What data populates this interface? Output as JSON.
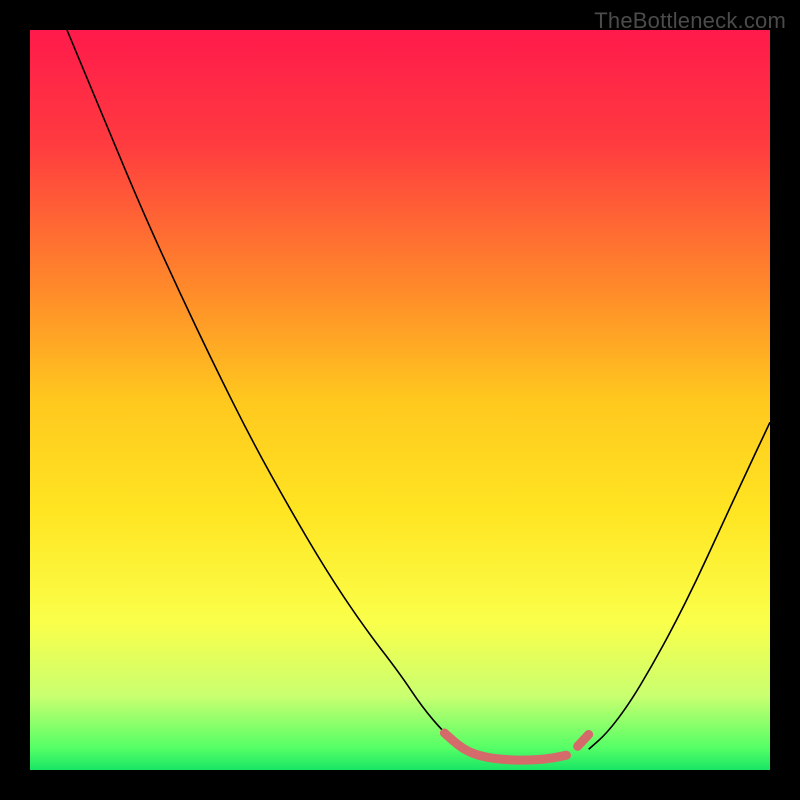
{
  "watermark": "TheBottleneck.com",
  "chart_data": {
    "type": "line",
    "title": "",
    "xlabel": "",
    "ylabel": "",
    "xlim": [
      0,
      100
    ],
    "ylim": [
      0,
      100
    ],
    "grid": false,
    "legend": "none",
    "background_gradient": {
      "stops": [
        {
          "pos": 0.0,
          "color": "#ff1a4b"
        },
        {
          "pos": 0.15,
          "color": "#ff3a40"
        },
        {
          "pos": 0.35,
          "color": "#ff8a2a"
        },
        {
          "pos": 0.5,
          "color": "#ffc81e"
        },
        {
          "pos": 0.65,
          "color": "#ffe522"
        },
        {
          "pos": 0.8,
          "color": "#faff4a"
        },
        {
          "pos": 0.9,
          "color": "#c9ff70"
        },
        {
          "pos": 0.97,
          "color": "#55ff66"
        },
        {
          "pos": 1.0,
          "color": "#19e565"
        }
      ]
    },
    "series": [
      {
        "name": "left-curve",
        "color": "#000000",
        "width": 1.6,
        "points": [
          {
            "x": 5.0,
            "y": 100.0
          },
          {
            "x": 10.0,
            "y": 88.0
          },
          {
            "x": 15.0,
            "y": 76.0
          },
          {
            "x": 20.0,
            "y": 65.0
          },
          {
            "x": 25.0,
            "y": 54.5
          },
          {
            "x": 30.0,
            "y": 44.5
          },
          {
            "x": 35.0,
            "y": 35.5
          },
          {
            "x": 40.0,
            "y": 27.0
          },
          {
            "x": 45.0,
            "y": 19.5
          },
          {
            "x": 50.0,
            "y": 13.0
          },
          {
            "x": 53.0,
            "y": 8.5
          },
          {
            "x": 56.0,
            "y": 5.0
          },
          {
            "x": 58.5,
            "y": 2.8
          }
        ]
      },
      {
        "name": "right-curve",
        "color": "#000000",
        "width": 1.6,
        "points": [
          {
            "x": 75.5,
            "y": 2.8
          },
          {
            "x": 78.0,
            "y": 5.0
          },
          {
            "x": 81.0,
            "y": 9.0
          },
          {
            "x": 84.0,
            "y": 14.0
          },
          {
            "x": 87.0,
            "y": 19.5
          },
          {
            "x": 90.0,
            "y": 25.5
          },
          {
            "x": 93.0,
            "y": 32.0
          },
          {
            "x": 96.0,
            "y": 38.5
          },
          {
            "x": 100.0,
            "y": 47.0
          }
        ]
      },
      {
        "name": "valley-segment",
        "color": "#d46a6a",
        "width": 9,
        "linecap": "round",
        "points": [
          {
            "x": 56.0,
            "y": 5.0
          },
          {
            "x": 58.5,
            "y": 2.8
          },
          {
            "x": 61.0,
            "y": 1.8
          },
          {
            "x": 64.0,
            "y": 1.4
          },
          {
            "x": 67.0,
            "y": 1.3
          },
          {
            "x": 70.0,
            "y": 1.5
          },
          {
            "x": 72.5,
            "y": 2.0
          }
        ]
      },
      {
        "name": "valley-dot-right",
        "color": "#d46a6a",
        "width": 9,
        "linecap": "round",
        "points": [
          {
            "x": 74.0,
            "y": 3.2
          },
          {
            "x": 75.5,
            "y": 4.8
          }
        ]
      }
    ]
  }
}
